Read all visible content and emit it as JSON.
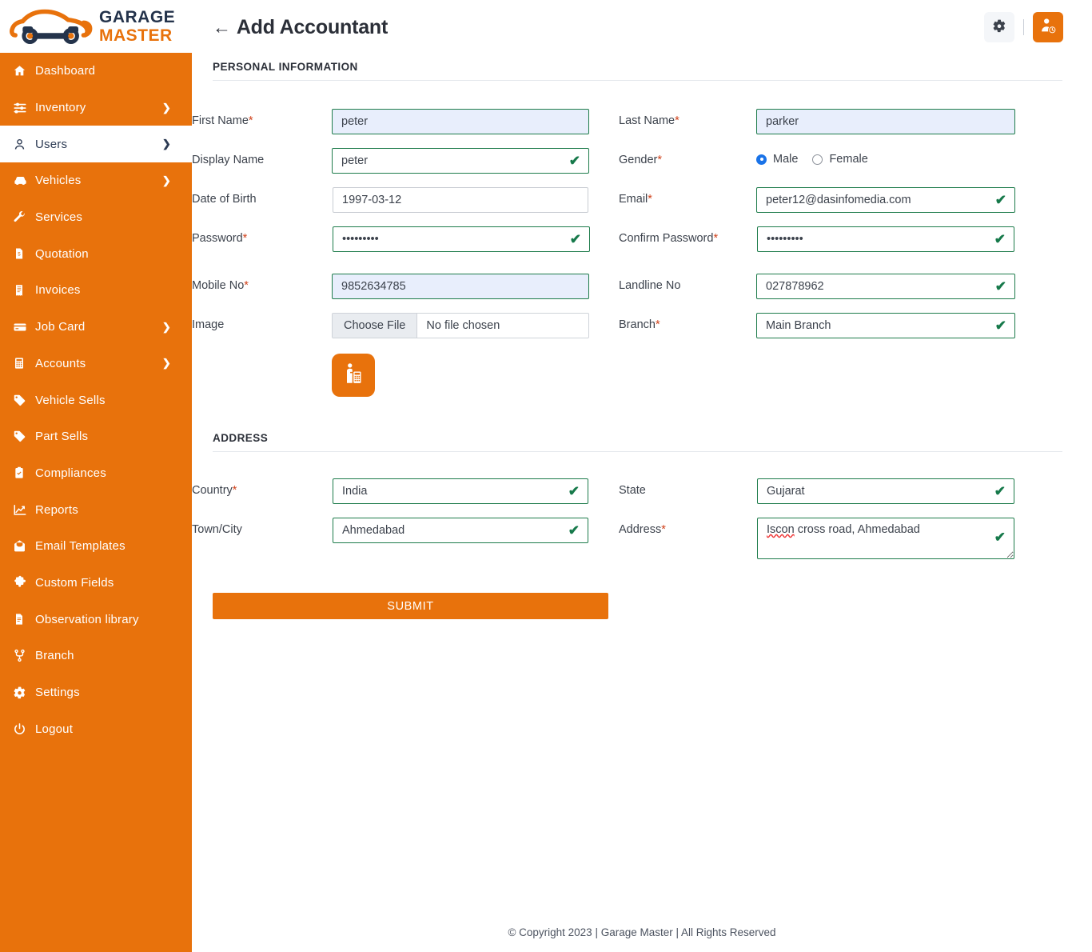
{
  "brand": {
    "logo_line1": "GARAGE",
    "logo_line2": "MASTER",
    "logo_icon": "car-wrench-logo",
    "accent_color": "#e8720c",
    "dark_color": "#24334b"
  },
  "sidebar": {
    "items": [
      {
        "label": "Dashboard",
        "icon": "home-icon",
        "chevron": "",
        "active": false
      },
      {
        "label": "Inventory",
        "icon": "sliders-icon",
        "chevron": "❯",
        "active": false
      },
      {
        "label": "Users",
        "icon": "user-icon",
        "chevron": "❯",
        "active": true
      },
      {
        "label": "Vehicles",
        "icon": "car-icon",
        "chevron": "❯",
        "active": false
      },
      {
        "label": "Services",
        "icon": "wrench-icon",
        "chevron": "",
        "active": false
      },
      {
        "label": "Quotation",
        "icon": "quote-doc-icon",
        "chevron": "",
        "active": false
      },
      {
        "label": "Invoices",
        "icon": "receipt-icon",
        "chevron": "",
        "active": false
      },
      {
        "label": "Job Card",
        "icon": "card-icon",
        "chevron": "❯",
        "active": false
      },
      {
        "label": "Accounts",
        "icon": "calculator-icon",
        "chevron": "❯",
        "active": false
      },
      {
        "label": "Vehicle Sells",
        "icon": "tag-icon",
        "chevron": "",
        "active": false
      },
      {
        "label": "Part Sells",
        "icon": "tag-icon",
        "chevron": "",
        "active": false
      },
      {
        "label": "Compliances",
        "icon": "clipboard-check-icon",
        "chevron": "",
        "active": false
      },
      {
        "label": "Reports",
        "icon": "chart-line-icon",
        "chevron": "",
        "active": false
      },
      {
        "label": "Email Templates",
        "icon": "mail-open-icon",
        "chevron": "",
        "active": false
      },
      {
        "label": "Custom Fields",
        "icon": "puzzle-icon",
        "chevron": "",
        "active": false
      },
      {
        "label": "Observation library",
        "icon": "document-icon",
        "chevron": "",
        "active": false
      },
      {
        "label": "Branch",
        "icon": "branch-icon",
        "chevron": "",
        "active": false
      },
      {
        "label": "Settings",
        "icon": "gear-icon",
        "chevron": "",
        "active": false
      },
      {
        "label": "Logout",
        "icon": "power-icon",
        "chevron": "",
        "active": false
      }
    ]
  },
  "header": {
    "back_arrow": "←",
    "title": "Add Accountant",
    "settings_icon": "gear-icon",
    "accountant_icon": "user-clock-icon"
  },
  "sections": {
    "personal": {
      "title": "PERSONAL INFORMATION"
    },
    "address": {
      "title": "ADDRESS"
    }
  },
  "form": {
    "first_name": {
      "label": "First Name",
      "required": "*",
      "value": "peter"
    },
    "last_name": {
      "label": "Last Name",
      "required": "*",
      "value": "parker"
    },
    "display_name": {
      "label": "Display Name",
      "required": "",
      "value": "peter"
    },
    "gender": {
      "label": "Gender",
      "required": "*",
      "options": [
        {
          "label": "Male",
          "selected": true
        },
        {
          "label": "Female",
          "selected": false
        }
      ]
    },
    "dob": {
      "label": "Date of Birth",
      "required": "",
      "value": "1997-03-12"
    },
    "email": {
      "label": "Email",
      "required": "*",
      "value": "peter12@dasinfomedia.com"
    },
    "password": {
      "label": "Password",
      "required": "*",
      "value": "•••••••••"
    },
    "confirm_password": {
      "label": "Confirm Password",
      "required": "*",
      "value": "•••••••••"
    },
    "mobile": {
      "label": "Mobile No",
      "required": "*",
      "value": "9852634785"
    },
    "landline": {
      "label": "Landline No",
      "required": "",
      "value": "027878962"
    },
    "image": {
      "label": "Image",
      "required": "",
      "button": "Choose File",
      "file_status": "No file chosen",
      "preview_icon": "accountant-avatar-icon"
    },
    "branch": {
      "label": "Branch",
      "required": "*",
      "value": "Main Branch"
    },
    "country": {
      "label": "Country",
      "required": "*",
      "value": "India"
    },
    "state": {
      "label": "State",
      "required": "",
      "value": "Gujarat"
    },
    "town_city": {
      "label": "Town/City",
      "required": "",
      "value": "Ahmedabad"
    },
    "address": {
      "label": "Address",
      "required": "*",
      "value": "Iscon cross road, Ahmedabad",
      "misspelled_word": "Iscon",
      "rest": " cross road, Ahmedabad"
    },
    "submit": {
      "label": "SUBMIT"
    },
    "valid_tick": "✔"
  },
  "footer": {
    "text": "© Copyright 2023 | Garage Master | All Rights Reserved"
  }
}
